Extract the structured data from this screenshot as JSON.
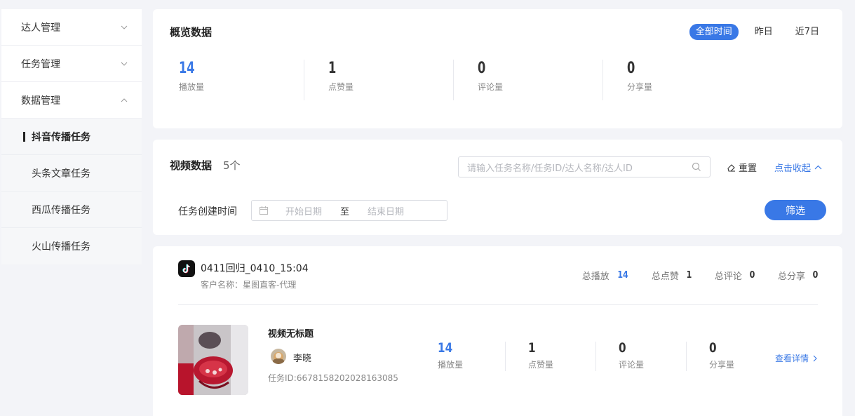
{
  "sidebar": {
    "items": [
      {
        "label": "达人管理",
        "expanded": false
      },
      {
        "label": "任务管理",
        "expanded": false
      },
      {
        "label": "数据管理",
        "expanded": true
      }
    ],
    "subitems": [
      "抖音传播任务",
      "头条文章任务",
      "西瓜传播任务",
      "火山传播任务"
    ],
    "active_subitem": "抖音传播任务"
  },
  "overview": {
    "title": "概览数据",
    "time_tabs": [
      "全部时间",
      "昨日",
      "近7日"
    ],
    "active_tab": "全部时间",
    "stats": [
      {
        "value": "14",
        "label": "播放量"
      },
      {
        "value": "1",
        "label": "点赞量"
      },
      {
        "value": "0",
        "label": "评论量"
      },
      {
        "value": "0",
        "label": "分享量"
      }
    ]
  },
  "video_data": {
    "title": "视频数据",
    "count": "5个",
    "search_placeholder": "请输入任务名称/任务ID/达人名称/达人ID",
    "reset_label": "重置",
    "collapse_label": "点击收起",
    "filter_label": "任务创建时间",
    "date_start_placeholder": "开始日期",
    "date_separator": "至",
    "date_end_placeholder": "结束日期",
    "filter_button": "筛选"
  },
  "task": {
    "name": "0411回归_0410_15:04",
    "client": "客户名称：星图直客-代理",
    "totals": [
      {
        "label": "总播放",
        "value": "14"
      },
      {
        "label": "总点赞",
        "value": "1"
      },
      {
        "label": "总评论",
        "value": "0"
      },
      {
        "label": "总分享",
        "value": "0"
      }
    ],
    "video": {
      "title": "视频无标题",
      "author": "李晓",
      "task_id": "任务ID:6678158202028163085",
      "stats": [
        {
          "value": "14",
          "label": "播放量"
        },
        {
          "value": "1",
          "label": "点赞量"
        },
        {
          "value": "0",
          "label": "评论量"
        },
        {
          "value": "0",
          "label": "分享量"
        }
      ],
      "detail_link": "查看详情"
    }
  },
  "colors": {
    "accent": "#3978e6",
    "background": "#f3f4f8"
  }
}
